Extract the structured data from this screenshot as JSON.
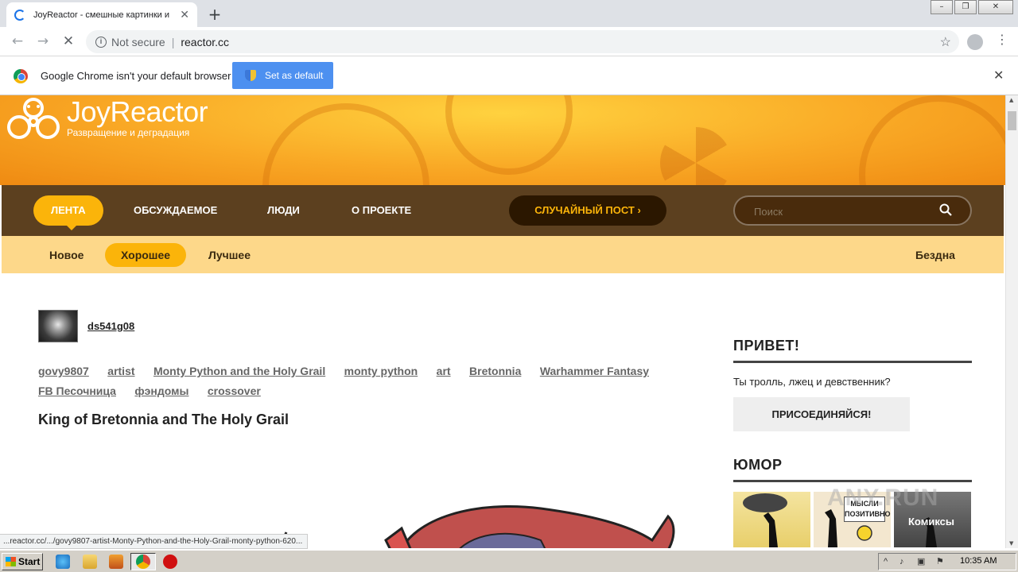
{
  "browser": {
    "tab_title": "JoyReactor - смешные картинки и",
    "tab_close": "✕",
    "new_tab": "+",
    "address_security": "Not secure",
    "address_separator": "|",
    "address_url": "reactor.cc",
    "status_url": "...reactor.cc/.../govy9807-artist-Monty-Python-and-the-Holy-Grail-monty-python-620..."
  },
  "infobar": {
    "message": "Google Chrome isn't your default browser",
    "set_default_label": "Set as default",
    "close": "✕"
  },
  "site": {
    "logo_title": "JoyReactor",
    "logo_subtitle": "Развращение и деградация",
    "nav": {
      "feed": "ЛЕНТА",
      "discussed": "ОБСУЖДАЕМОЕ",
      "people": "ЛЮДИ",
      "about": "О ПРОЕКТЕ",
      "random_post": "СЛУЧАЙНЫЙ ПОСТ  ›"
    },
    "search_placeholder": "Поиск",
    "subnav": {
      "new": "Новое",
      "good": "Хорошее",
      "best": "Лучшее",
      "abyss": "Бездна"
    }
  },
  "post": {
    "username": "ds541g08",
    "tags": [
      "govy9807",
      "artist",
      "Monty Python and the Holy Grail",
      "monty python",
      "art",
      "Bretonnia",
      "Warhammer Fantasy",
      "FB Песочница",
      "фэндомы",
      "crossover"
    ],
    "title": "King of Bretonnia and The Holy Grail"
  },
  "sidebar": {
    "greeting_heading": "ПРИВЕТ!",
    "greeting_text": "Ты тролль, лжец и девственник?",
    "join_label": "ПРИСОЕДИНЯЙСЯ!",
    "humor_heading": "ЮМОР",
    "thumb2_sign": "МЫСЛИ ПОЗИТИВНО",
    "thumb3_caption": "Комиксы"
  },
  "watermark": "ANY.RUN",
  "taskbar": {
    "start_label": "Start",
    "clock": "10:35 AM"
  },
  "colors": {
    "accent": "#fbb40a",
    "nav_bg": "#462600",
    "subnav_bg": "#fdd88a",
    "chrome_blue": "#4d90f0"
  }
}
